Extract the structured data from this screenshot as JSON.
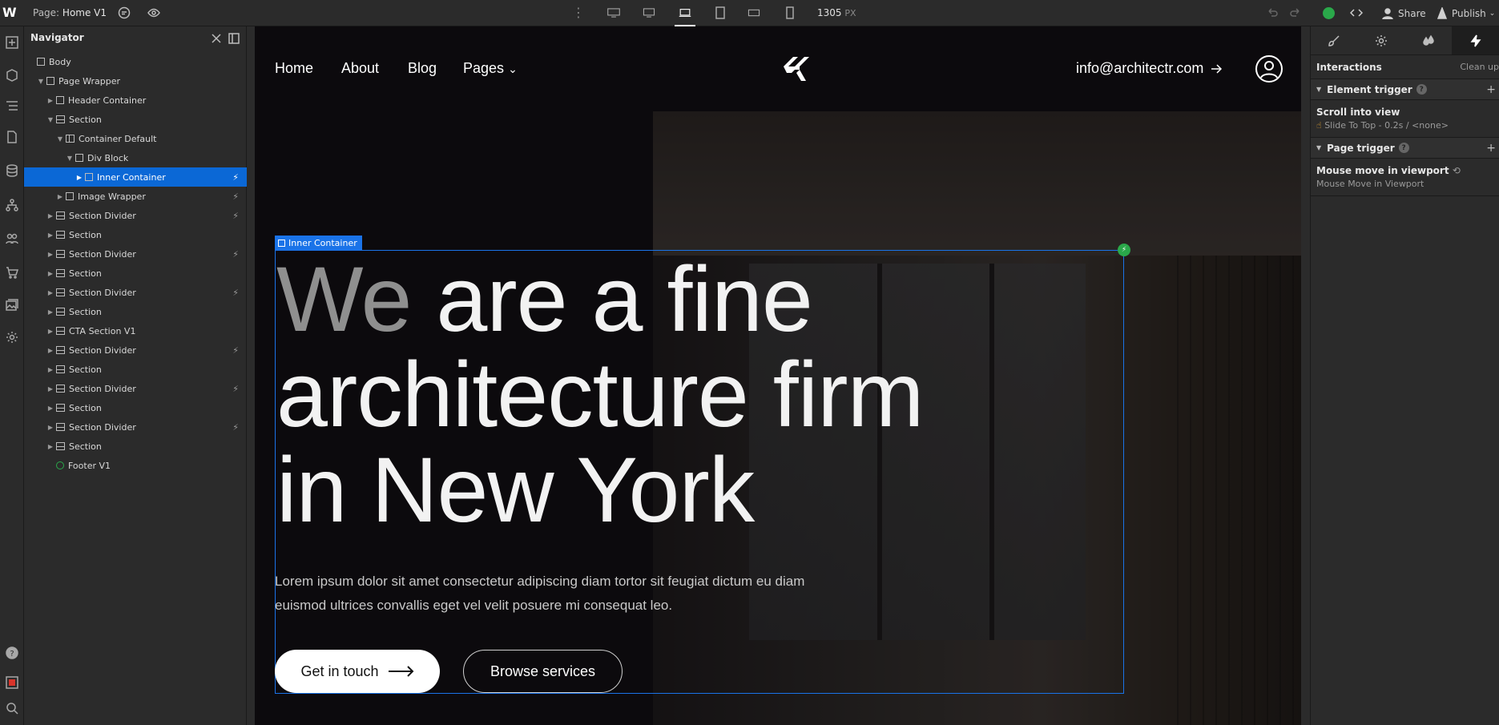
{
  "topbar": {
    "logo": "W",
    "page_prefix": "Page:",
    "page_name": "Home V1",
    "width_value": "1305",
    "width_unit": "PX",
    "share_label": "Share",
    "publish_label": "Publish"
  },
  "navigator": {
    "title": "Navigator",
    "items": [
      {
        "label": "Body"
      },
      {
        "label": "Page Wrapper"
      },
      {
        "label": "Header Container"
      },
      {
        "label": "Section"
      },
      {
        "label": "Container Default"
      },
      {
        "label": "Div Block"
      },
      {
        "label": "Inner Container"
      },
      {
        "label": "Image Wrapper"
      },
      {
        "label": "Section Divider"
      },
      {
        "label": "Section"
      },
      {
        "label": "Section Divider"
      },
      {
        "label": "Section"
      },
      {
        "label": "Section Divider"
      },
      {
        "label": "Section"
      },
      {
        "label": "CTA Section V1"
      },
      {
        "label": "Section Divider"
      },
      {
        "label": "Section"
      },
      {
        "label": "Section Divider"
      },
      {
        "label": "Section"
      },
      {
        "label": "Section Divider"
      },
      {
        "label": "Section"
      },
      {
        "label": "Footer V1"
      }
    ],
    "selected": "Inner Container"
  },
  "site": {
    "nav": {
      "home": "Home",
      "about": "About",
      "blog": "Blog",
      "pages": "Pages"
    },
    "email": "info@architectr.com",
    "selection_label": "Inner Container",
    "hero_title_faded": "We",
    "hero_title_rest_1": " are a fine",
    "hero_title_line_2": "architecture firm",
    "hero_title_line_3": "in New York",
    "hero_body": "Lorem ipsum dolor sit amet consectetur adipiscing diam tortor sit feugiat dictum eu diam euismod ultrices convallis eget vel velit posuere mi consequat leo.",
    "btn_primary": "Get in touch",
    "btn_secondary": "Browse services"
  },
  "panel": {
    "title": "Interactions",
    "clean_up": "Clean up",
    "element_trigger": "Element trigger",
    "element_trigger_item": "Scroll into view",
    "element_trigger_detail": "Slide To Top - 0.2s / <none>",
    "page_trigger": "Page trigger",
    "page_trigger_item": "Mouse move in viewport",
    "page_trigger_detail": "Mouse Move in Viewport"
  },
  "colors": {
    "accent": "#0b68d6",
    "success": "#2aa84a",
    "canvas": "#0c0a0d"
  }
}
